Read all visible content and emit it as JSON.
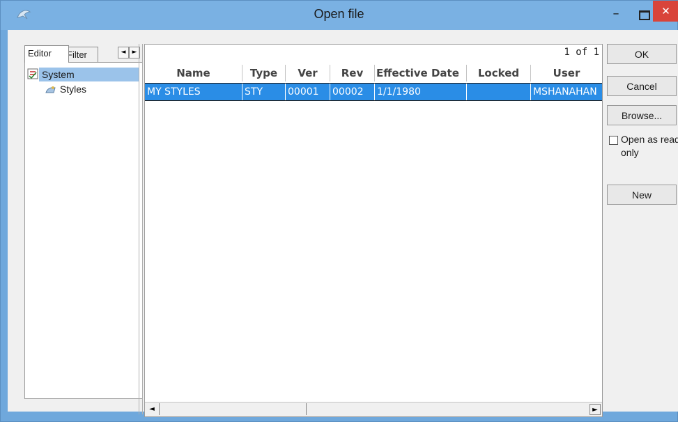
{
  "window": {
    "title": "Open file",
    "minimize_glyph": "–",
    "close_glyph": "✕",
    "app_icon": "dolphin-icon"
  },
  "tabs": [
    {
      "label": "Editor",
      "active": true
    },
    {
      "label": "Filter",
      "active": false
    }
  ],
  "tab_scroll": {
    "left": "◄",
    "right": "►"
  },
  "tree": {
    "items": [
      {
        "label": "System",
        "icon": "system-checklist-icon",
        "selected": true
      },
      {
        "label": "Styles",
        "icon": "styles-icon",
        "selected": false
      }
    ]
  },
  "grid": {
    "page_count": "1 of 1",
    "columns": [
      "Name",
      "Type",
      "Ver",
      "Rev",
      "Effective Date",
      "Locked",
      "User"
    ],
    "rows": [
      {
        "name": "MY STYLES",
        "type": "STY",
        "ver": "00001",
        "rev": "00002",
        "effective_date": "1/1/1980",
        "locked": "",
        "user": "MSHANAHAN",
        "selected": true
      }
    ],
    "scroll": {
      "left": "◄",
      "right": "►"
    }
  },
  "buttons": {
    "ok": "OK",
    "cancel": "Cancel",
    "browse": "Browse...",
    "new": "New"
  },
  "open_readonly": {
    "label": "Open as read-only",
    "checked": false
  },
  "colors": {
    "titlebar": "#7ab1e3",
    "selection": "#2a8de6",
    "tree_selection": "#9bc3ea",
    "close": "#d9443a"
  }
}
